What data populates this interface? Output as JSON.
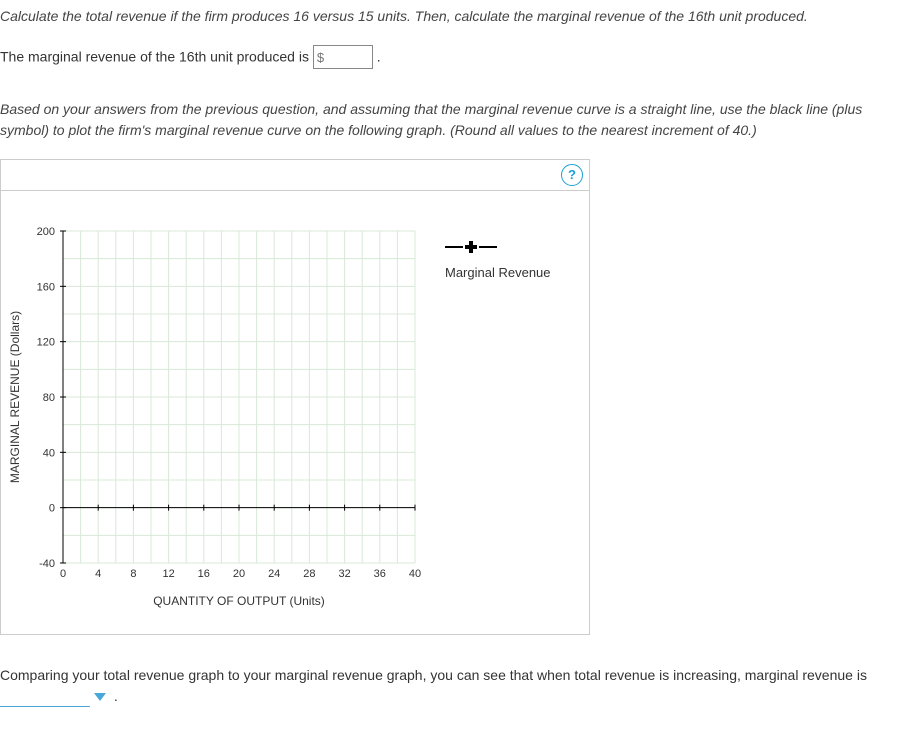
{
  "q1_instruction": "Calculate the total revenue if the firm produces 16 versus 15 units. Then, calculate the marginal revenue of the 16th unit produced.",
  "q1_answer_prefix": "The marginal revenue of the 16th unit produced is ",
  "q1_input_placeholder": "$",
  "q1_answer_suffix": " .",
  "q2_instruction": "Based on your answers from the previous question, and assuming that the marginal revenue curve is a straight line, use the black line (plus symbol) to plot the firm's marginal revenue curve on the following graph. (Round all values to the nearest increment of 40.)",
  "help_label": "?",
  "legend_label": "Marginal Revenue",
  "q3_text": "Comparing your total revenue graph to your marginal revenue graph, you can see that when total revenue is increasing, marginal revenue is",
  "q3_suffix": " .",
  "chart_data": {
    "type": "scatter",
    "title": "",
    "xlabel": "QUANTITY OF OUTPUT (Units)",
    "ylabel": "MARGINAL REVENUE (Dollars)",
    "x_ticks": [
      0,
      4,
      8,
      12,
      16,
      20,
      24,
      28,
      32,
      36,
      40
    ],
    "y_ticks": [
      -40,
      0,
      40,
      80,
      120,
      160,
      200
    ],
    "xlim": [
      0,
      40
    ],
    "ylim": [
      -40,
      200
    ],
    "grid": true,
    "series": [
      {
        "name": "Marginal Revenue",
        "symbol": "plus-line",
        "color": "#000000",
        "x": [],
        "y": []
      }
    ]
  }
}
